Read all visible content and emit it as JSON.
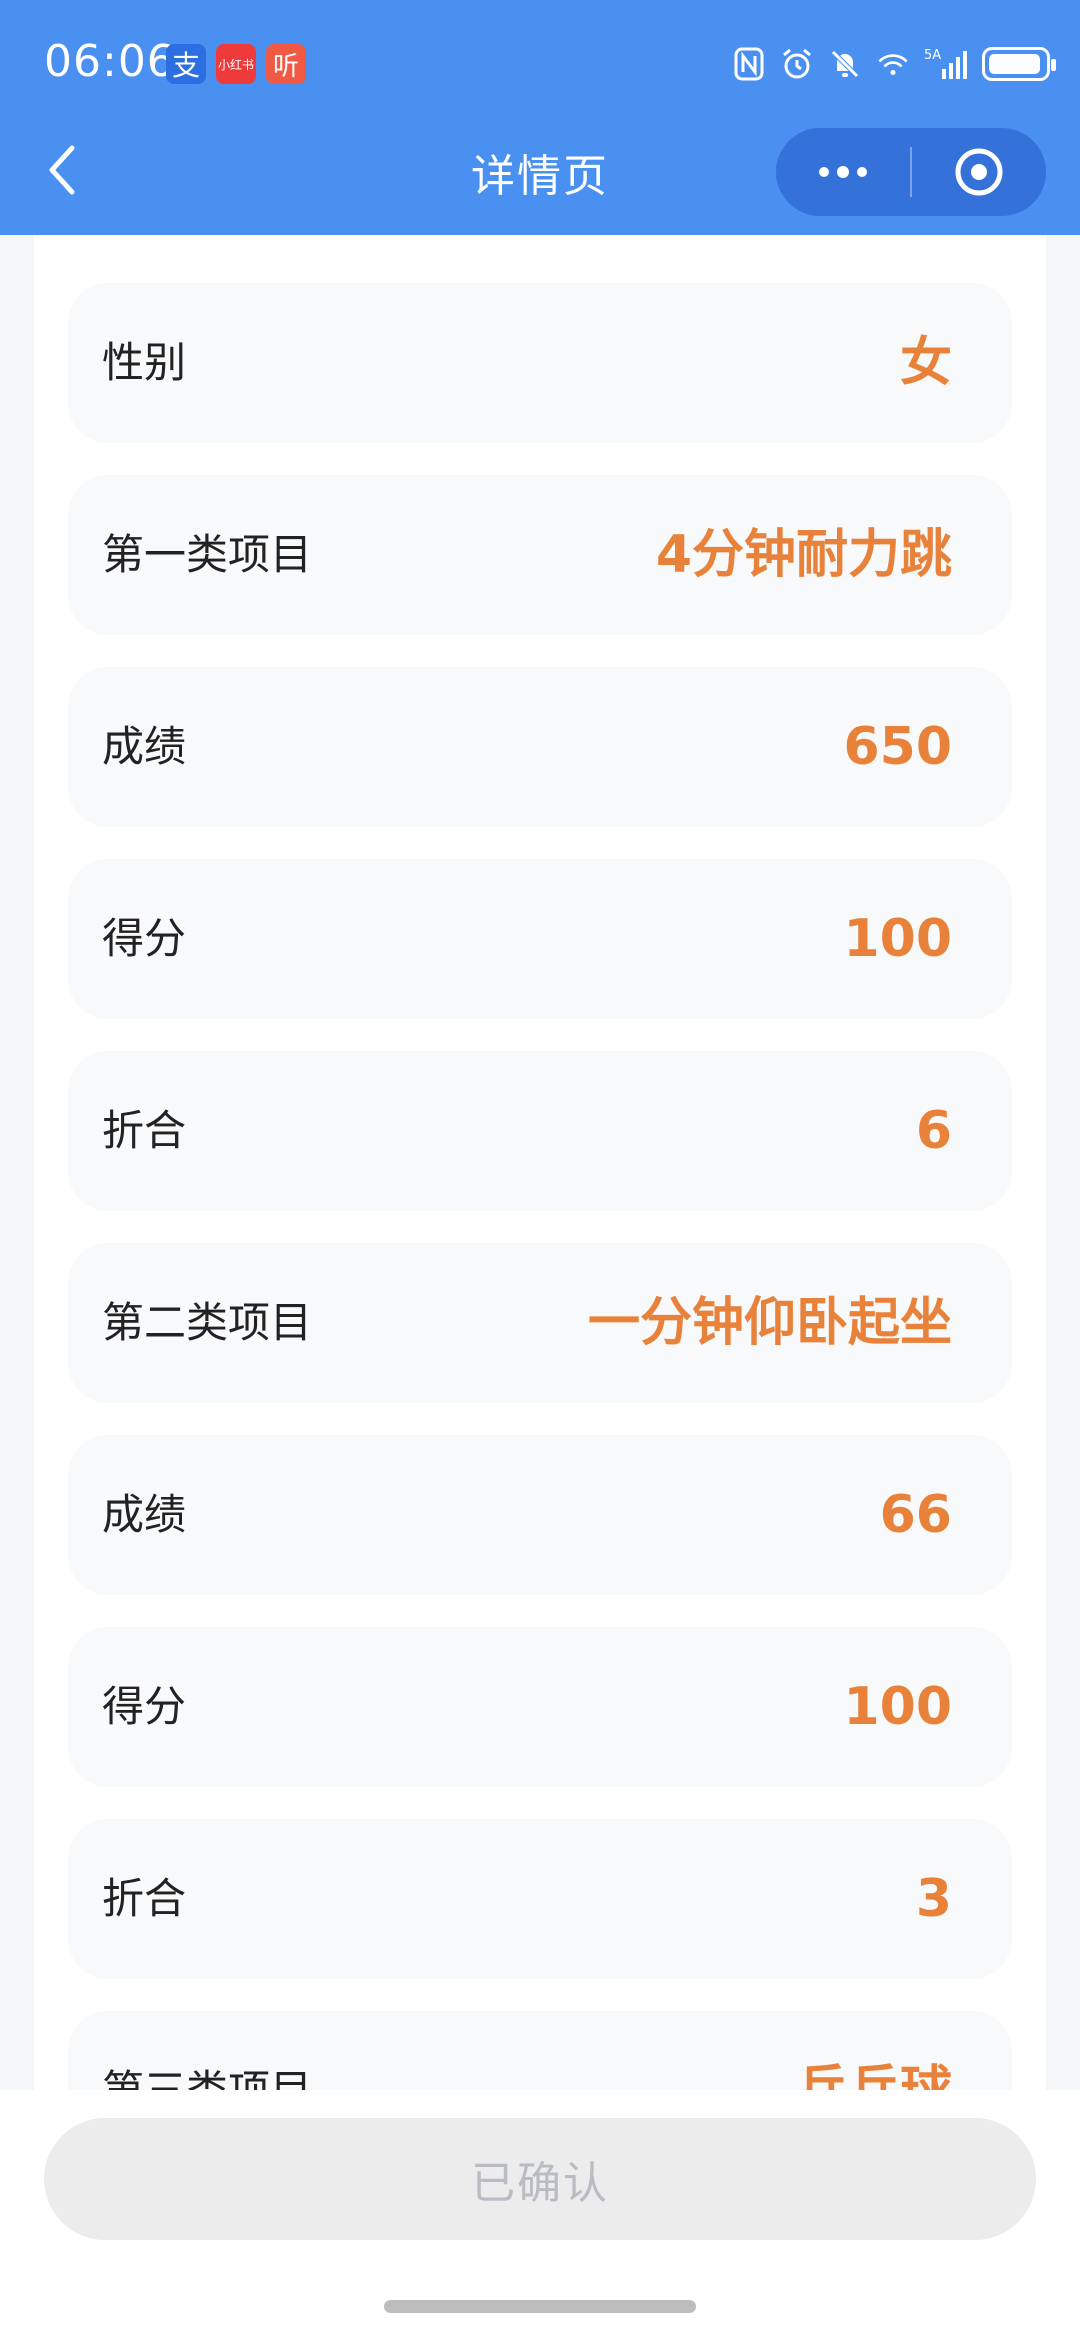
{
  "status_bar": {
    "time": "06:06",
    "apps": [
      {
        "name": "alipay-icon",
        "glyph": "支"
      },
      {
        "name": "xiaohongshu-icon",
        "glyph": "小红书"
      },
      {
        "name": "listen-app-icon",
        "glyph": "听"
      }
    ],
    "network": "5A",
    "battery_level": 0.95
  },
  "nav": {
    "title": "详情页"
  },
  "rows": [
    {
      "label": "性别",
      "value": "女"
    },
    {
      "label": "第一类项目",
      "value": "4分钟耐力跳"
    },
    {
      "label": "成绩",
      "value": "650"
    },
    {
      "label": "得分",
      "value": "100"
    },
    {
      "label": "折合",
      "value": "6"
    },
    {
      "label": "第二类项目",
      "value": "一分钟仰卧起坐"
    },
    {
      "label": "成绩",
      "value": "66"
    },
    {
      "label": "得分",
      "value": "100"
    },
    {
      "label": "折合",
      "value": "3"
    },
    {
      "label": "第三类项目",
      "value": "乒乓球"
    }
  ],
  "footer": {
    "confirm_label": "已确认"
  },
  "colors": {
    "header_bg": "#4a90f0",
    "value_accent": "#e8823a",
    "row_bg": "#f8f9fb"
  }
}
